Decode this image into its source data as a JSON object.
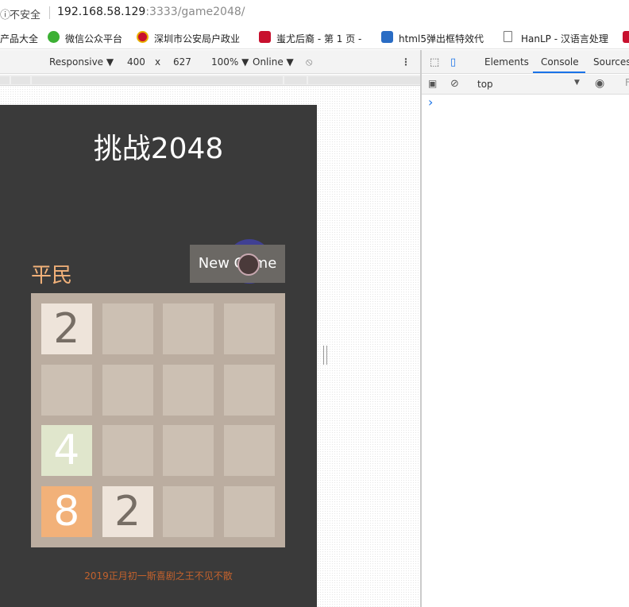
{
  "browser": {
    "security_label": "不安全",
    "url_host": "192.168.58.129",
    "url_path": ":3333/game2048/"
  },
  "bookmarks": [
    {
      "label": "产品大全",
      "icon": "bookmark-icon"
    },
    {
      "label": "微信公众平台",
      "icon": "wechat-icon"
    },
    {
      "label": "深圳市公安局户政业",
      "icon": "police-icon"
    },
    {
      "label": "蚩尤后裔 - 第 1 页 -",
      "icon": "c-logo-icon"
    },
    {
      "label": "html5弹出框特效代",
      "icon": "v-logo-icon"
    },
    {
      "label": "HanLP - 汉语言处理",
      "icon": "page-icon"
    }
  ],
  "device_toolbar": {
    "mode": "Responsive ▼",
    "width": "400",
    "times": "x",
    "height": "627",
    "zoom": "100% ▼",
    "network": "Online ▼"
  },
  "devtools": {
    "tabs": [
      "Elements",
      "Console",
      "Sources"
    ],
    "active_tab": "Console",
    "context": "top",
    "prompt": "›"
  },
  "game": {
    "title": "挑战2048",
    "rank": "平民",
    "new_game_label": "New Game",
    "footer": "2019正月初一斯喜剧之王不见不散",
    "grid": [
      [
        2,
        null,
        null,
        null
      ],
      [
        null,
        null,
        null,
        null
      ],
      [
        4,
        null,
        null,
        null
      ],
      [
        8,
        2,
        null,
        null
      ]
    ],
    "tile_colors": {
      "2": {
        "bg": "#eee4da",
        "fg": "#776e65"
      },
      "4": {
        "bg": "#e0e6cc",
        "fg": "#ffffff"
      },
      "8": {
        "bg": "#f2b179",
        "fg": "#ffffff"
      },
      "empty": "#ccc0b3",
      "board": "#bbada0",
      "page": "#3a3a3a"
    }
  }
}
